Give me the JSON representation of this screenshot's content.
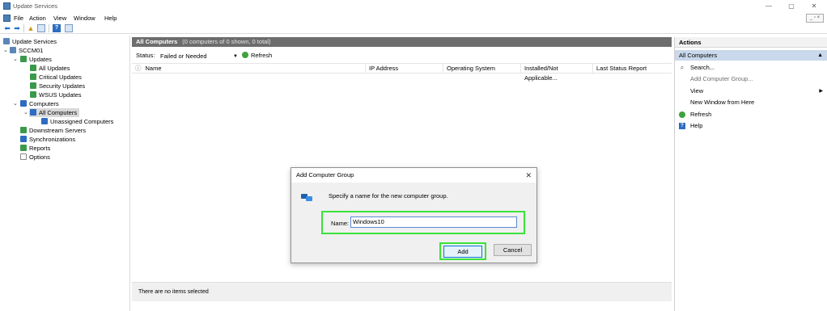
{
  "window": {
    "title": "Update Services",
    "controls": {
      "minimize": "—",
      "restore": "▢",
      "close": "✕"
    },
    "mdi_controls": "_ ▫ ×"
  },
  "menu": [
    "File",
    "Action",
    "View",
    "Window",
    "Help"
  ],
  "toolbar": {
    "back": "back-arrow-icon",
    "forward": "forward-arrow-icon"
  },
  "tree": {
    "root": "Update Services",
    "server": "SCCM01",
    "updates": "Updates",
    "all_updates": "All Updates",
    "critical_updates": "Critical Updates",
    "security_updates": "Security Updates",
    "wsus_updates": "WSUS Updates",
    "computers": "Computers",
    "all_computers": "All Computers",
    "unassigned_computers": "Unassigned Computers",
    "downstream_servers": "Downstream Servers",
    "synchronizations": "Synchronizations",
    "reports": "Reports",
    "options": "Options"
  },
  "center": {
    "header_title": "All Computers",
    "header_subtitle": "(0 computers of 0 shown, 0 total)",
    "status_label": "Status:",
    "status_value": "Failed or Needed",
    "refresh_label": "Refresh",
    "columns": [
      "Name",
      "IP Address",
      "Operating System",
      "Installed/Not Applicable...",
      "Last Status Report"
    ],
    "footer_text": "There are no items selected"
  },
  "actions": {
    "title": "Actions",
    "section": "All Computers",
    "items": {
      "search": "Search...",
      "add_group": "Add Computer Group...",
      "view": "View",
      "new_window": "New Window from Here",
      "refresh": "Refresh",
      "help": "Help"
    }
  },
  "dialog": {
    "title": "Add Computer Group",
    "prompt": "Specify a name for the new computer group.",
    "name_label": "Name:",
    "name_value": "Windows10",
    "add_label": "Add",
    "cancel_label": "Cancel",
    "highlight_color": "#39e339"
  }
}
